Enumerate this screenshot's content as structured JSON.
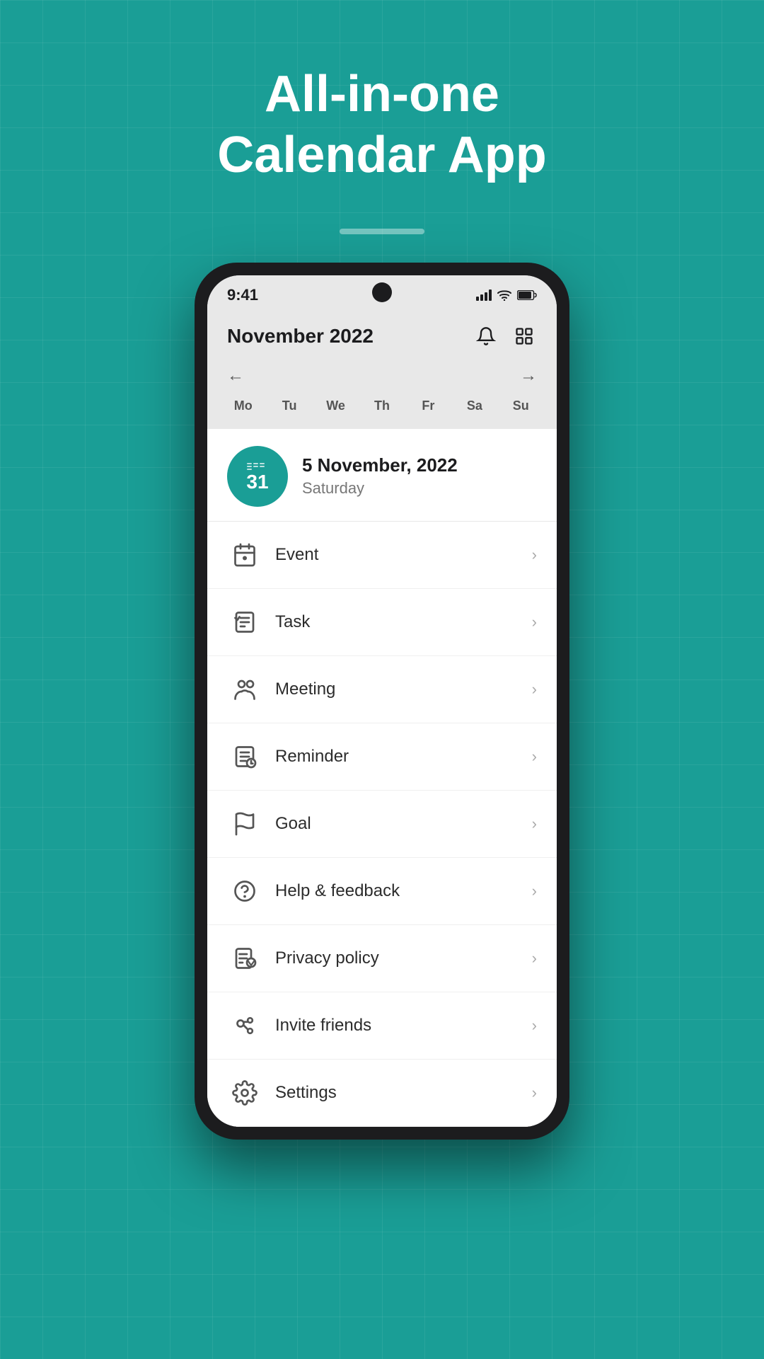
{
  "page": {
    "title_line1": "All-in-one",
    "title_line2": "Calendar App",
    "background_color": "#1a9e96"
  },
  "status_bar": {
    "time": "9:41",
    "signal_icon": "signal-icon",
    "wifi_icon": "wifi-icon",
    "battery_icon": "battery-icon"
  },
  "calendar_header": {
    "month_title": "November 2022",
    "bell_icon": "bell-icon",
    "grid_icon": "grid-icon"
  },
  "calendar_week": {
    "prev_arrow": "←",
    "next_arrow": "→",
    "days": [
      "Mo",
      "Tu",
      "We",
      "Th",
      "Fr",
      "Sa",
      "Su"
    ]
  },
  "date_header": {
    "badge_number": "31",
    "date_full": "5 November, 2022",
    "day_name": "Saturday"
  },
  "menu_items": [
    {
      "id": "event",
      "label": "Event",
      "icon": "event-icon"
    },
    {
      "id": "task",
      "label": "Task",
      "icon": "task-icon"
    },
    {
      "id": "meeting",
      "label": "Meeting",
      "icon": "meeting-icon"
    },
    {
      "id": "reminder",
      "label": "Reminder",
      "icon": "reminder-icon"
    },
    {
      "id": "goal",
      "label": "Goal",
      "icon": "goal-icon"
    },
    {
      "id": "help",
      "label": "Help & feedback",
      "icon": "help-icon"
    },
    {
      "id": "privacy",
      "label": "Privacy policy",
      "icon": "privacy-icon"
    },
    {
      "id": "invite",
      "label": "Invite friends",
      "icon": "invite-icon"
    },
    {
      "id": "settings",
      "label": "Settings",
      "icon": "settings-icon"
    }
  ]
}
